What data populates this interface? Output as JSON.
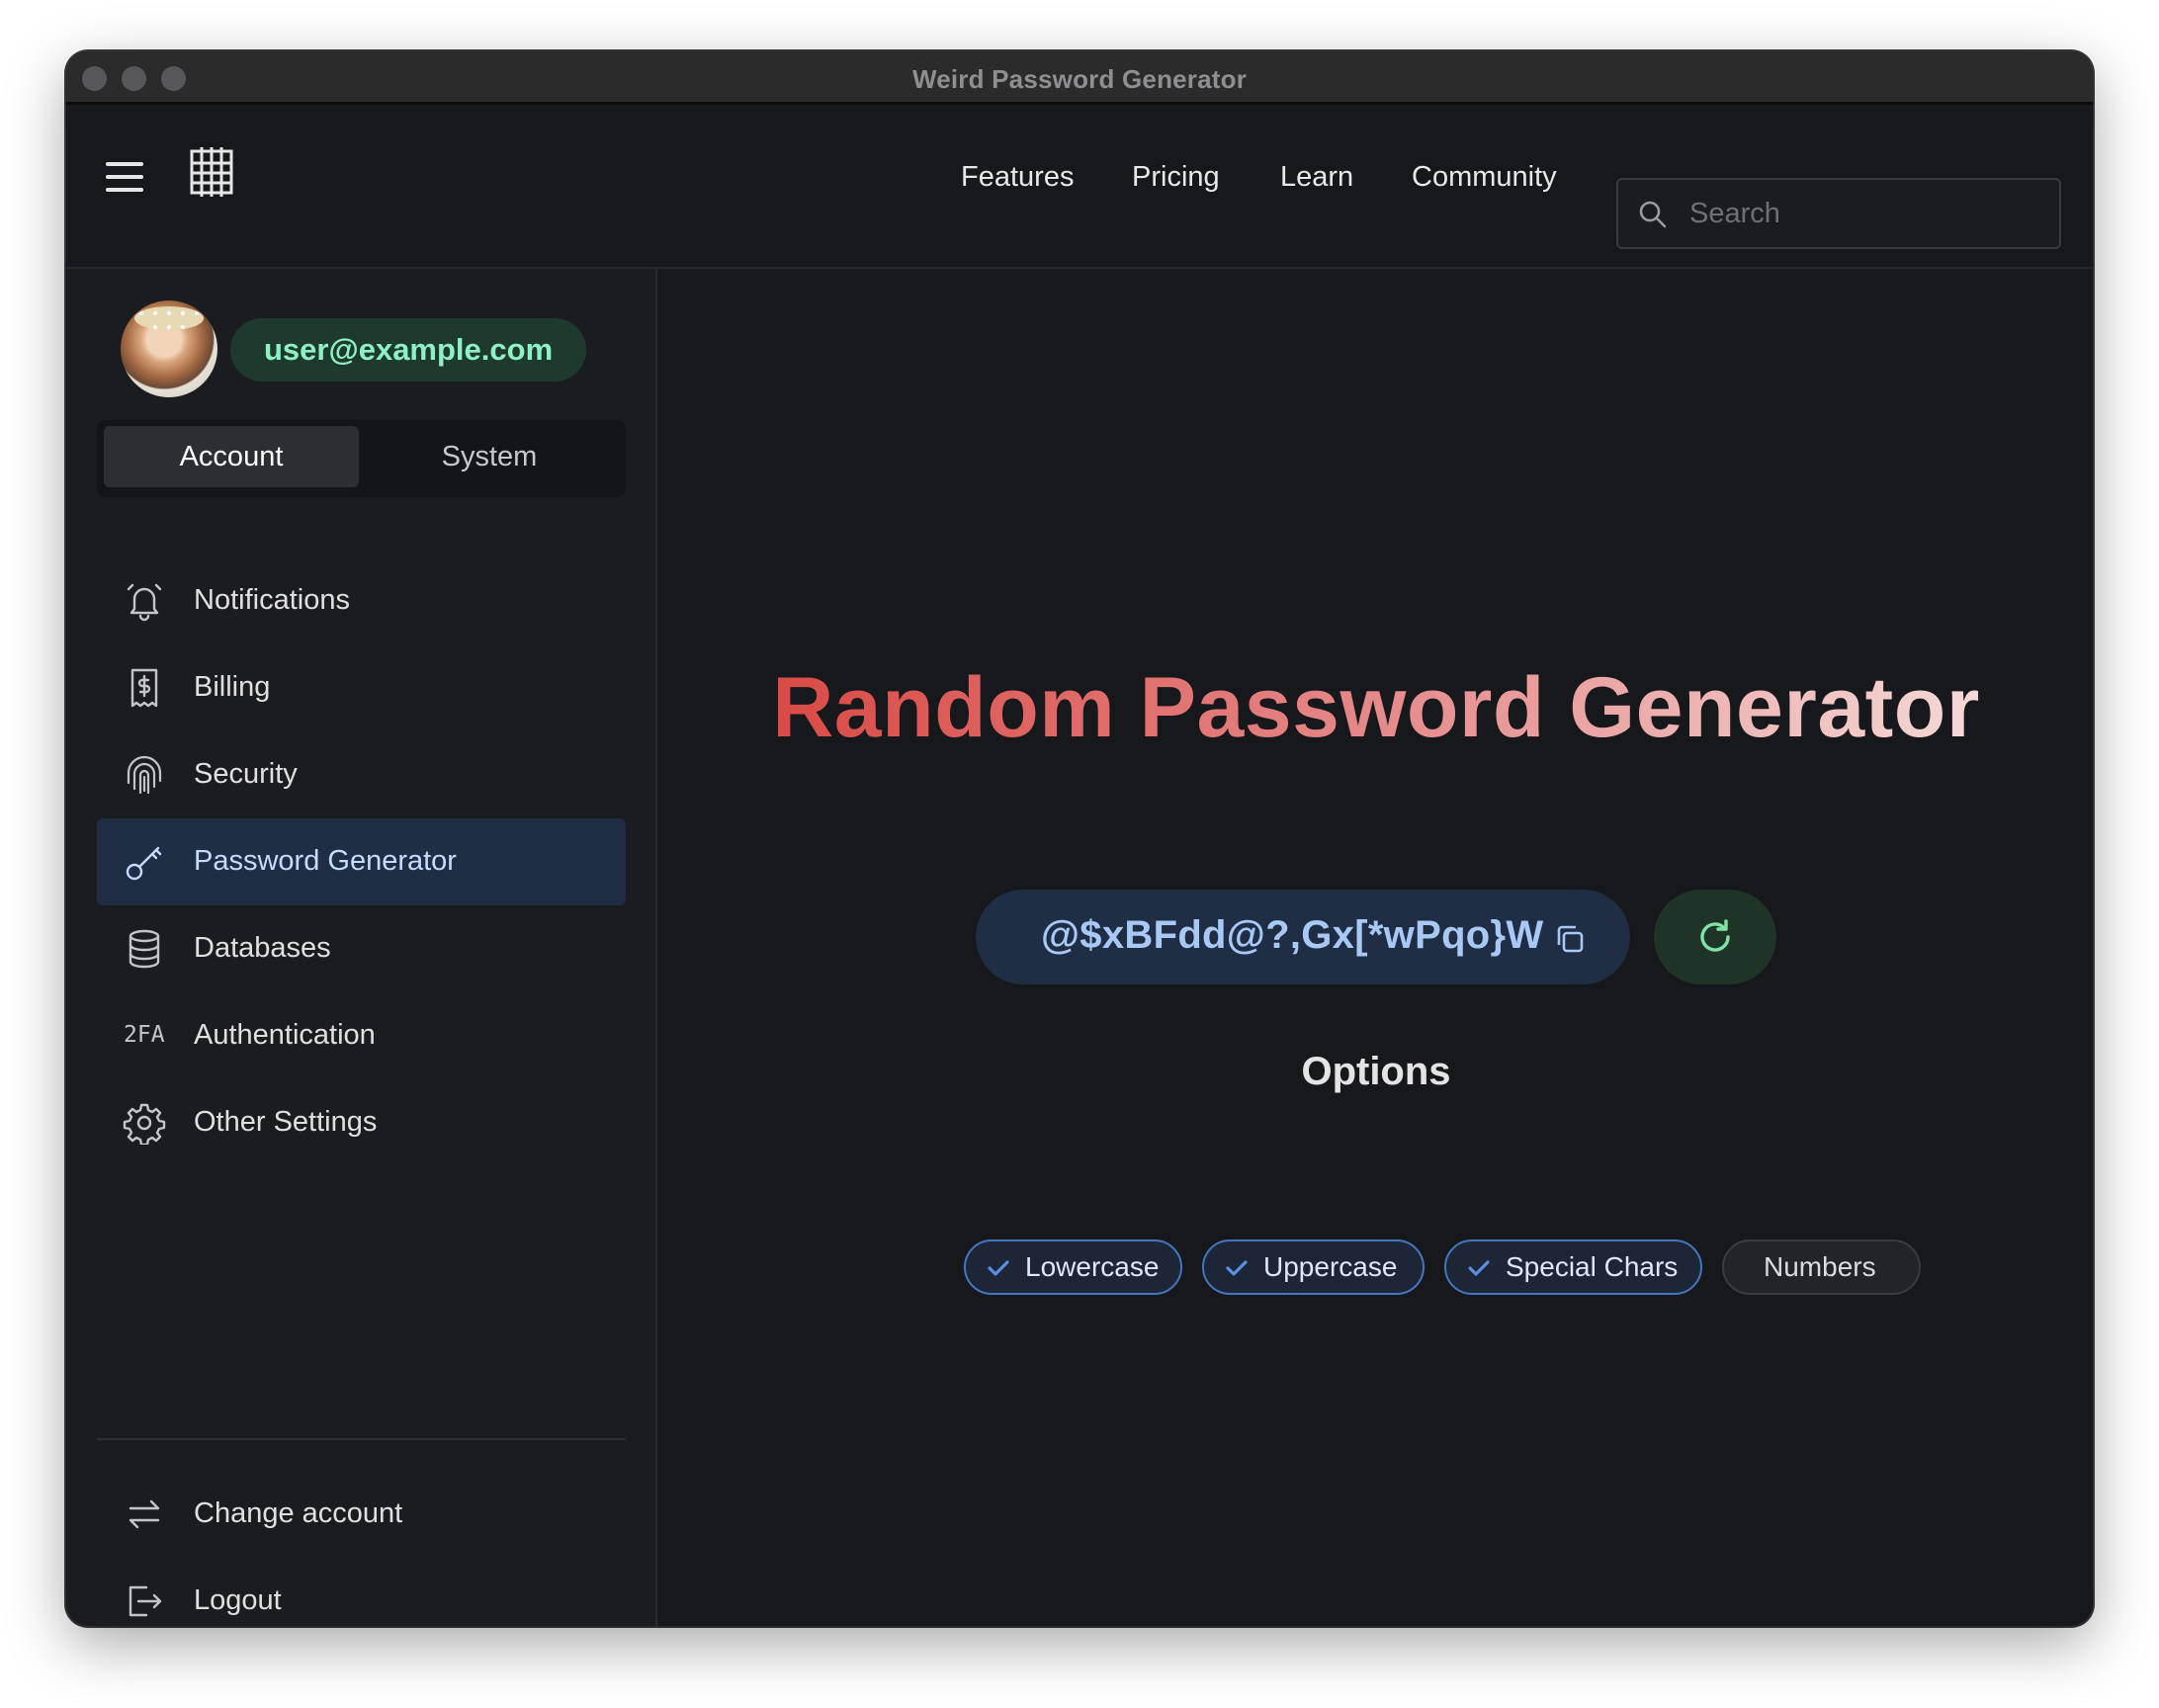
{
  "window": {
    "title": "Weird Password Generator"
  },
  "topnav": {
    "links": [
      "Features",
      "Pricing",
      "Learn",
      "Community"
    ],
    "search_placeholder": "Search"
  },
  "sidebar": {
    "email": "user@example.com",
    "tabs": [
      {
        "label": "Account",
        "active": true
      },
      {
        "label": "System",
        "active": false
      }
    ],
    "items": [
      {
        "label": "Notifications",
        "icon": "bell-icon"
      },
      {
        "label": "Billing",
        "icon": "receipt-dollar-icon"
      },
      {
        "label": "Security",
        "icon": "fingerprint-icon"
      },
      {
        "label": "Password Generator",
        "icon": "key-icon",
        "active": true
      },
      {
        "label": "Databases",
        "icon": "database-icon"
      },
      {
        "label": "Authentication",
        "icon": "2fa-icon",
        "icon_text": "2FA"
      },
      {
        "label": "Other Settings",
        "icon": "gear-icon"
      }
    ],
    "bottom_items": [
      {
        "label": "Change account",
        "icon": "switch-arrows-icon"
      },
      {
        "label": "Logout",
        "icon": "logout-icon"
      }
    ]
  },
  "main": {
    "title": "Random Password Generator",
    "password": "@$xBFdd@?,Gx[*wPqo}W",
    "options_title": "Options",
    "options": [
      {
        "label": "Lowercase",
        "checked": true
      },
      {
        "label": "Uppercase",
        "checked": true
      },
      {
        "label": "Special Chars",
        "checked": true
      },
      {
        "label": "Numbers",
        "checked": false
      }
    ]
  },
  "colors": {
    "accent_blue": "#4675c0",
    "email_green": "#8ef0c3",
    "title_gradient_start": "#d94a45",
    "title_gradient_end": "#f4d9d6"
  }
}
